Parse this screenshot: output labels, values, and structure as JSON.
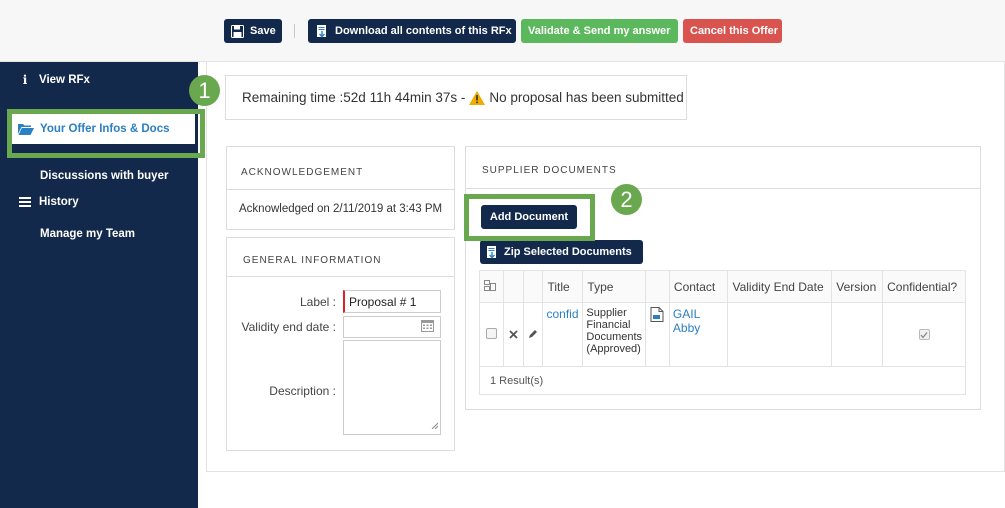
{
  "toolbar": {
    "save_label": "Save",
    "download_label": "Download all contents of this RFx",
    "validate_label": "Validate & Send my answer",
    "cancel_label": "Cancel this Offer"
  },
  "sidebar": {
    "items": [
      {
        "label": "View RFx",
        "icon": "info-icon"
      },
      {
        "label": "Your Offer Infos & Docs",
        "icon": "folder-open-icon",
        "active": true
      },
      {
        "label": "Discussions with buyer",
        "icon": ""
      },
      {
        "label": "History",
        "icon": "list-icon"
      },
      {
        "label": "Manage my Team",
        "icon": ""
      }
    ]
  },
  "annotations": {
    "badge1": "1",
    "badge2": "2",
    "highlight_color": "#6aa84f"
  },
  "status": {
    "remaining": "Remaining time :52d 11h 44min 37s - ",
    "proposal": "No proposal has been submitted"
  },
  "acknowledgement": {
    "title": "ACKNOWLEDGEMENT",
    "text": "Acknowledged on 2/11/2019 at 3:43 PM"
  },
  "general": {
    "title": "GENERAL INFORMATION",
    "label_label": "Label :",
    "label_value": "Proposal # 1",
    "validity_label": "Validity end date :",
    "validity_value": "",
    "description_label": "Description :",
    "description_value": ""
  },
  "supplier": {
    "title": "SUPPLIER DOCUMENTS",
    "add_label": "Add Document",
    "zip_label": "Zip Selected Documents",
    "columns": [
      "Title",
      "Type",
      "Contact",
      "Validity End Date",
      "Version",
      "Confidential?"
    ],
    "row": {
      "title": "confid",
      "type_lines": [
        "Supplier",
        "Financial",
        "Documents",
        "(Approved)"
      ],
      "contact": "GAIL Abby",
      "validity": "",
      "version": "",
      "confidential": true
    },
    "result_count": "1 Result(s)"
  },
  "colors": {
    "navy": "#13294b",
    "green": "#5cb85c",
    "red": "#d9534f",
    "link": "#2b7fc3"
  }
}
